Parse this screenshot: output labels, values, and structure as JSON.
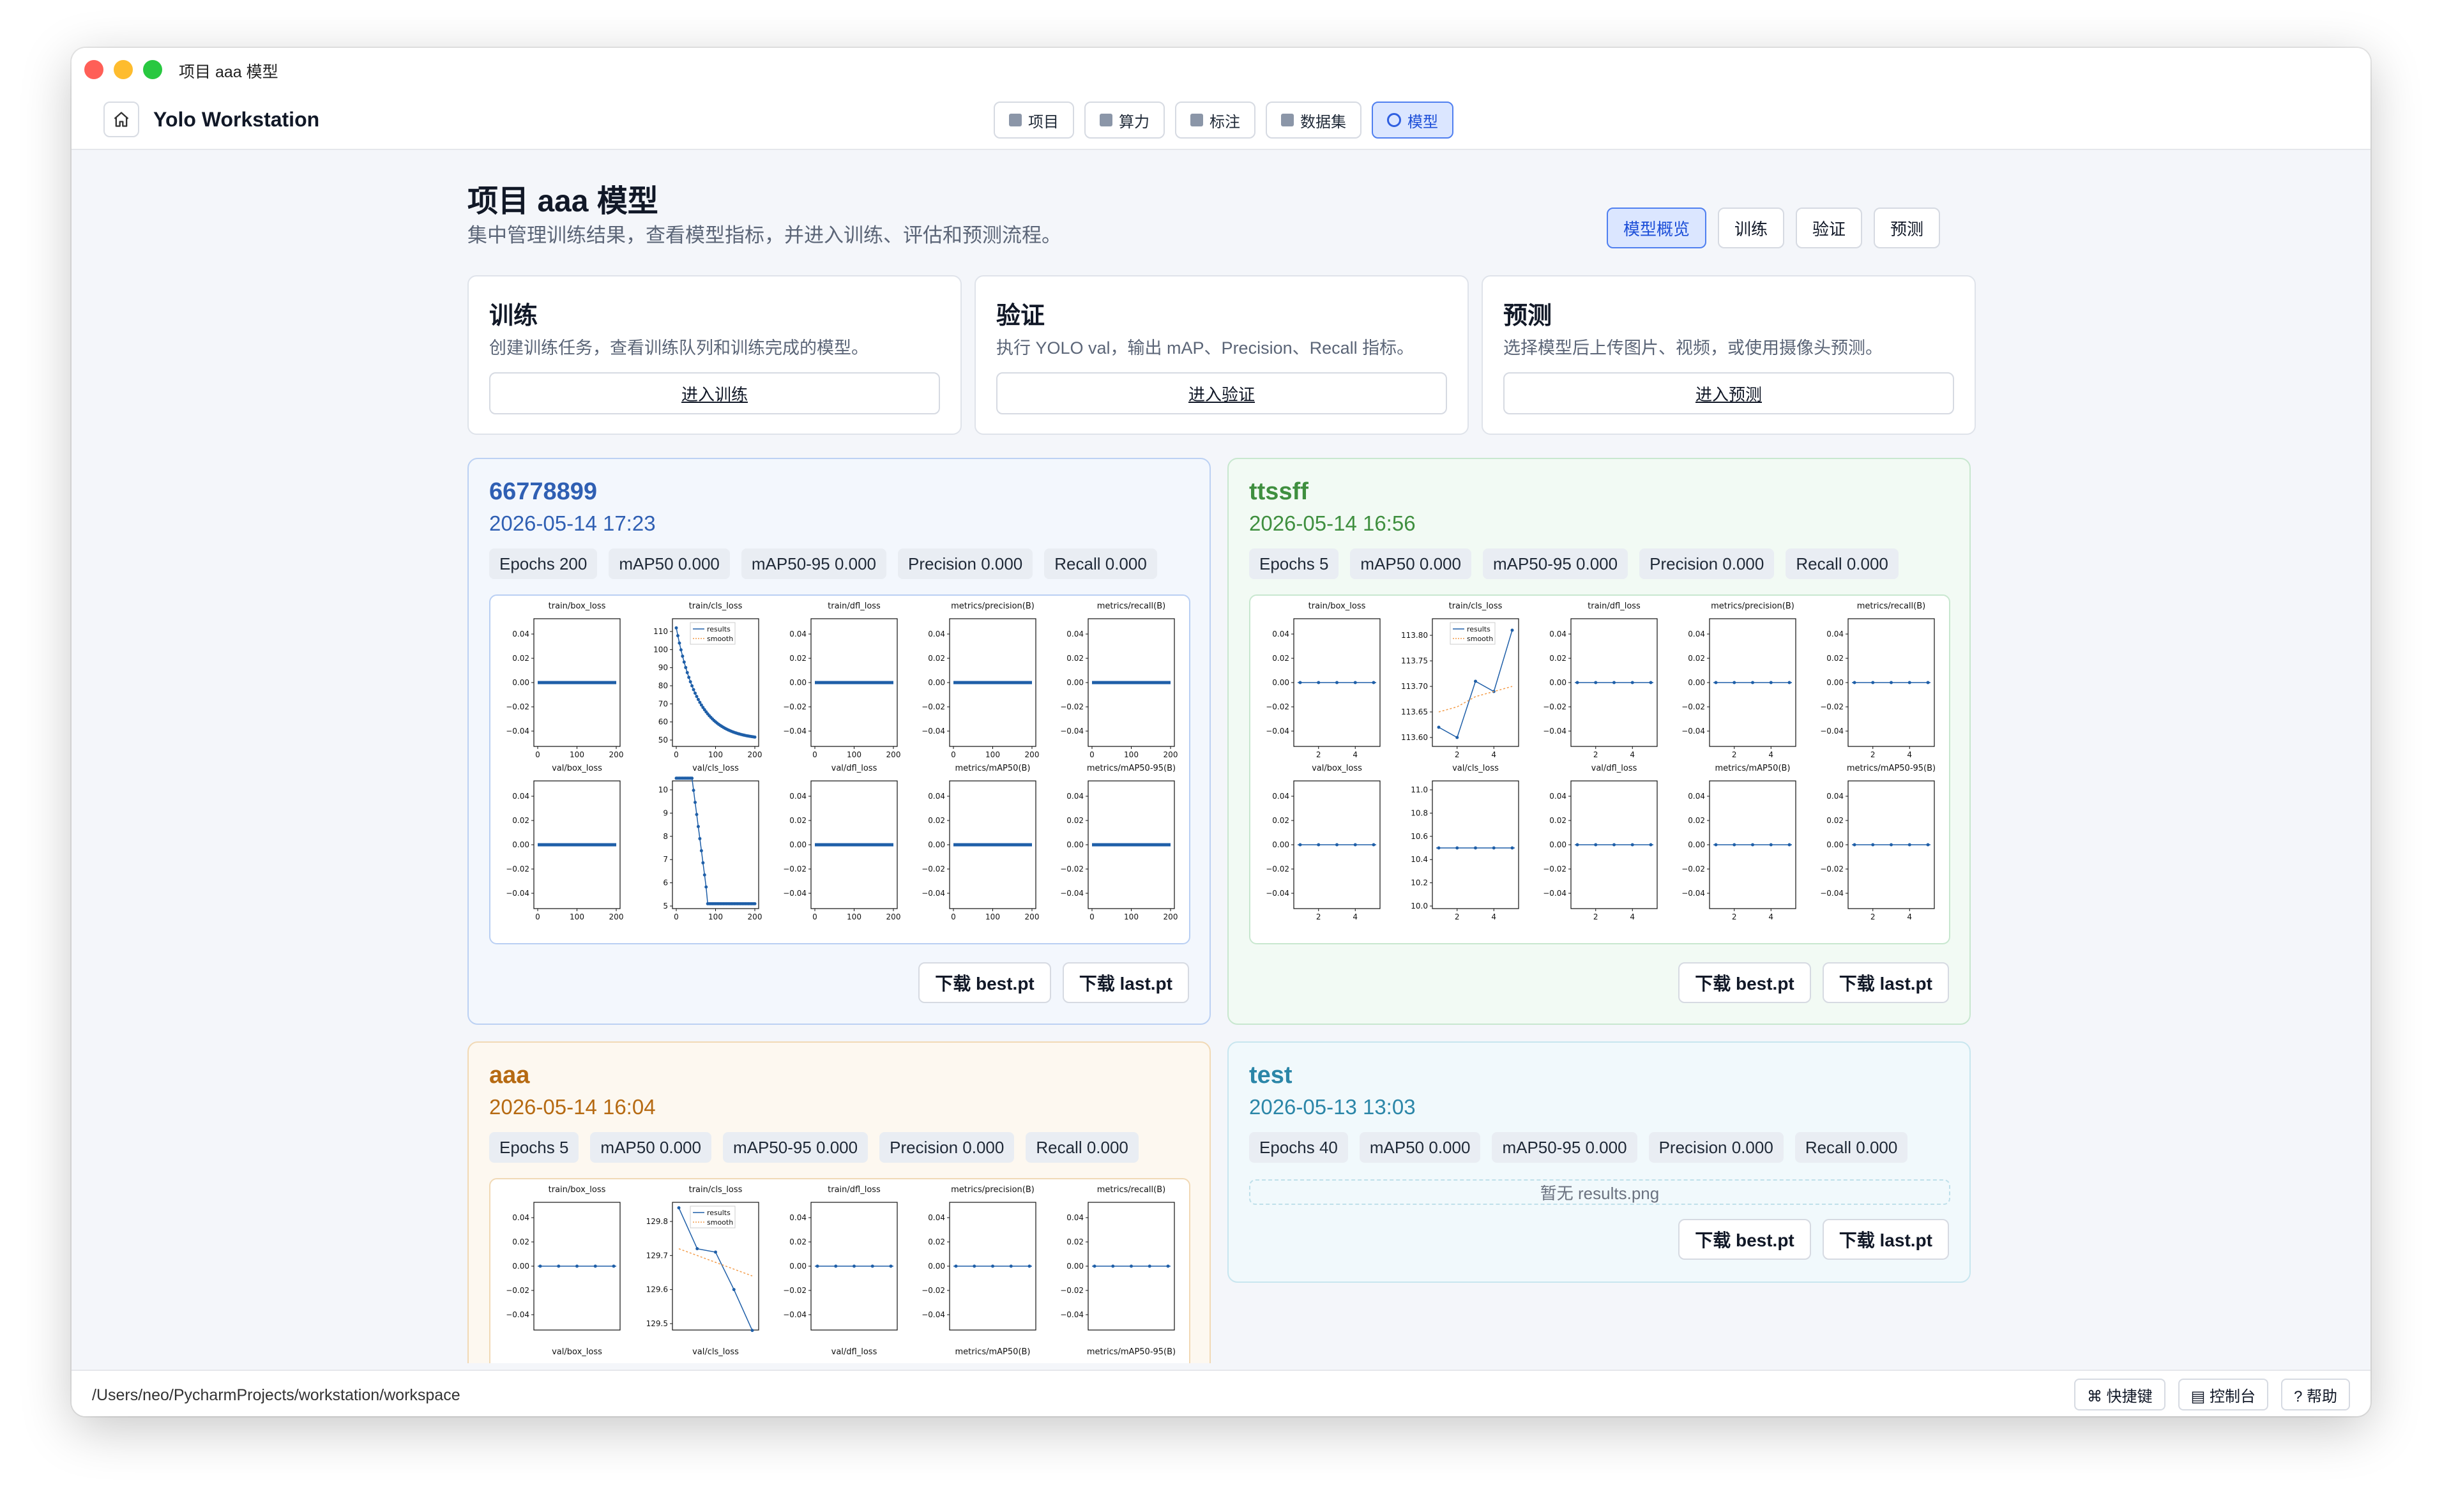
{
  "window": {
    "title": "项目 aaa 模型"
  },
  "app": {
    "name": "Yolo Workstation"
  },
  "nav": {
    "tabs": [
      {
        "label": "项目",
        "icon": "square-icon"
      },
      {
        "label": "算力",
        "icon": "square-icon"
      },
      {
        "label": "标注",
        "icon": "square-icon"
      },
      {
        "label": "数据集",
        "icon": "square-icon"
      },
      {
        "label": "模型",
        "icon": "ring-icon",
        "active": true
      }
    ]
  },
  "page": {
    "title": "项目 aaa 模型",
    "subtitle": "集中管理训练结果，查看模型指标，并进入训练、评估和预测流程。"
  },
  "subtabs": [
    {
      "label": "模型概览",
      "active": true
    },
    {
      "label": "训练"
    },
    {
      "label": "验证"
    },
    {
      "label": "预测"
    }
  ],
  "actions": [
    {
      "title": "训练",
      "desc": "创建训练任务，查看训练队列和训练完成的模型。",
      "button": "进入训练"
    },
    {
      "title": "验证",
      "desc": "执行 YOLO val，输出 mAP、Precision、Recall 指标。",
      "button": "进入验证"
    },
    {
      "title": "预测",
      "desc": "选择模型后上传图片、视频，或使用摄像头预测。",
      "button": "进入预测"
    }
  ],
  "models": [
    {
      "name": "66778899",
      "date": "2026-05-14 17:23",
      "accent": "#2f5fb3",
      "stats": [
        "Epochs 200",
        "mAP50 0.000",
        "mAP50-95 0.000",
        "Precision 0.000",
        "Recall 0.000"
      ],
      "buttons": [
        "下载 best.pt",
        "下载 last.pt"
      ]
    },
    {
      "name": "ttssff",
      "date": "2026-05-14 16:56",
      "accent": "#3f8f3f",
      "stats": [
        "Epochs 5",
        "mAP50 0.000",
        "mAP50-95 0.000",
        "Precision 0.000",
        "Recall 0.000"
      ],
      "buttons": [
        "下载 best.pt",
        "下载 last.pt"
      ]
    },
    {
      "name": "aaa",
      "date": "2026-05-14 16:04",
      "accent": "#b66a12",
      "stats": [
        "Epochs 5",
        "mAP50 0.000",
        "mAP50-95 0.000",
        "Precision 0.000",
        "Recall 0.000"
      ],
      "buttons": []
    },
    {
      "name": "test",
      "date": "2026-05-13 13:03",
      "accent": "#2b86a8",
      "stats": [
        "Epochs 40",
        "mAP50 0.000",
        "mAP50-95 0.000",
        "Precision 0.000",
        "Recall 0.000"
      ],
      "no_results": "暂无 results.png",
      "buttons": [
        "下载 best.pt",
        "下载 last.pt"
      ]
    }
  ],
  "plot_titles": [
    "train/box_loss",
    "train/cls_loss",
    "train/dfl_loss",
    "metrics/precision(B)",
    "metrics/recall(B)",
    "val/box_loss",
    "val/cls_loss",
    "val/dfl_loss",
    "metrics/mAP50(B)",
    "metrics/mAP50-95(B)"
  ],
  "plot_legend": [
    "results",
    "smooth"
  ],
  "plots": {
    "zero_yticks": [
      "0.04",
      "0.02",
      "0.00",
      "−0.02",
      "−0.04"
    ],
    "p1": {
      "xticks": [
        "0",
        "100",
        "200"
      ],
      "train_cls_yticks": [
        "110",
        "100",
        "90",
        "80",
        "70",
        "60",
        "50"
      ],
      "val_cls_yticks": [
        "10",
        "9",
        "8",
        "7",
        "6",
        "5"
      ]
    },
    "p2": {
      "xticks": [
        "2",
        "4"
      ],
      "train_cls_yticks": [
        "113.80",
        "113.75",
        "113.70",
        "113.65",
        "113.60"
      ],
      "train_cls_values": [
        113.62,
        113.6,
        113.71,
        113.69,
        113.81
      ],
      "val_cls_yticks": [
        "11.0",
        "10.8",
        "10.6",
        "10.4",
        "10.2",
        "10.0"
      ]
    },
    "p3": {
      "train_cls_yticks": [
        "129.8",
        "129.7",
        "129.6",
        "129.5"
      ],
      "train_cls_values": [
        129.84,
        129.72,
        129.71,
        129.6,
        129.48
      ]
    }
  },
  "footer": {
    "path": "/Users/neo/PycharmProjects/workstation/workspace",
    "buttons": [
      {
        "label": "⌘ 快捷键"
      },
      {
        "label": "▤ 控制台"
      },
      {
        "label": "? 帮助"
      }
    ]
  }
}
